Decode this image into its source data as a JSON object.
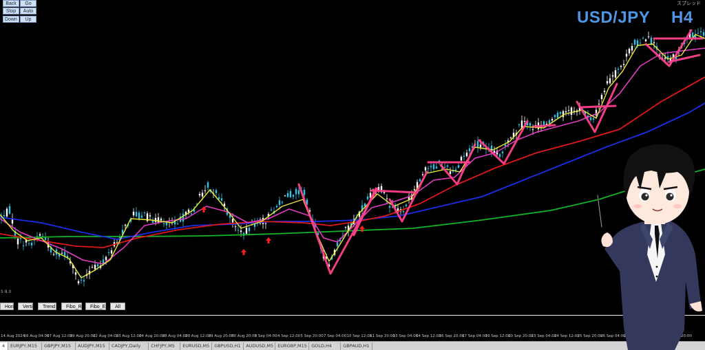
{
  "nav_buttons": {
    "back": "Back",
    "go": "Go",
    "stop": "Stop",
    "auto": "Auto",
    "down": "Down",
    "up": "Up"
  },
  "chart_title": {
    "symbol": "USD/JPY",
    "timeframe": "H4"
  },
  "spread_label": "スプレッド",
  "side_label": "S 8.0",
  "toolbar": [
    "Horiz",
    "Verti",
    "Trend",
    "Fibo_R",
    "Fibo_E",
    "All"
  ],
  "time_ticks": [
    "14 Aug 2024",
    "16 Aug 04:00",
    "17 Aug 12:00",
    "19 Aug 20:00",
    "22 Aug 04:00",
    "23 Aug 12:00",
    "24 Aug 20:00",
    "28 Aug 04:00",
    "29 Aug 12:00",
    "29 Aug 20:00",
    "30 Aug 20:00",
    "3 Sep 04:00",
    "4 Sep 12:00",
    "5 Sep 20:00",
    "7 Sep 04:00",
    "10 Sep 12:00",
    "11 Sep 20:00",
    "13 Sep 04:00",
    "14 Sep 12:00",
    "16 Sep 20:00",
    "17 Sep 04:00",
    "19 Sep 12:00",
    "20 Sep 20:00",
    "23 Sep 04:00",
    "24 Sep 12:00",
    "25 Sep 20:00",
    "26 Sep 04:00",
    "27 Sep 12:00",
    "1 Oct 04:00",
    "2 Oct 20:00"
  ],
  "tabs": [
    "4",
    "EURJPY,M15",
    "GBPJPY,M15",
    "AUDJPY,M15",
    "CADJPY,Daily",
    "CHFJPY,M5",
    "EURUSD,M5",
    "GBPUSD,H1",
    "AUDUSD,M5",
    "EURGBP,M15",
    "GOLD,H4",
    "GBPAUD,H1"
  ],
  "colors": {
    "bull": "#2ec4e6",
    "bear": "#ffffff",
    "ma_fast": "#e8e83a",
    "ma_mid": "#e23cc4",
    "ma_red": "#e01818",
    "ma_blue": "#1a2ee8",
    "ma_green": "#14b428",
    "marker": "#ff3f8a",
    "arrow": "#ff1e1e",
    "title": "#4f97e4"
  }
}
